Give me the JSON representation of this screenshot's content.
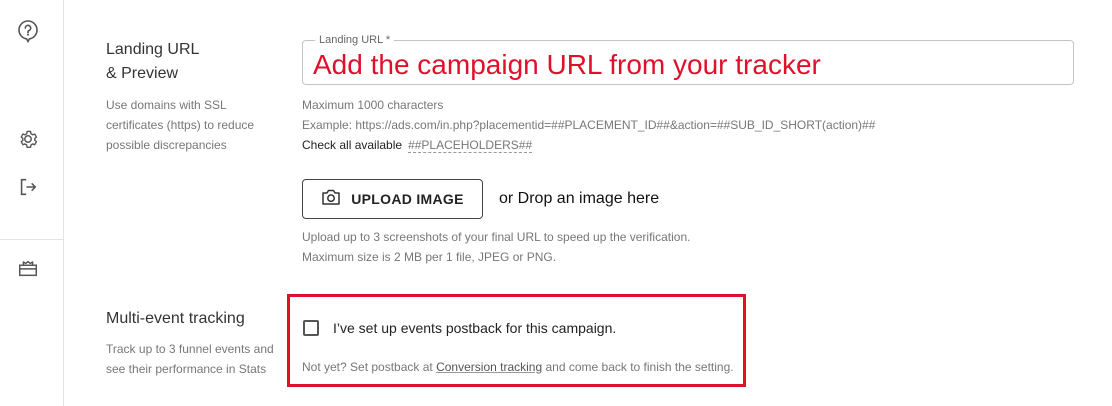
{
  "sidebar": {
    "icons": [
      "help-icon",
      "gear-icon",
      "logout-icon",
      "gift-icon"
    ]
  },
  "landing": {
    "title_line1": "Landing URL",
    "title_line2": "& Preview",
    "desc_line1": "Use domains with SSL",
    "desc_line2": "certificates (https) to reduce",
    "desc_line3": "possible discrepancies",
    "field_label": "Landing URL *",
    "field_annotation": "Add the campaign URL from your tracker",
    "max_chars": "Maximum 1000 characters",
    "example": "Example: https://ads.com/in.php?placementid=##PLACEMENT_ID##&action=##SUB_ID_SHORT(action)##",
    "check_all": "Check all available",
    "placeholders_link": "##PLACEHOLDERS##"
  },
  "upload": {
    "button_label": "UPLOAD IMAGE",
    "drop_text": "or Drop an image here",
    "help_line1": "Upload up to 3 screenshots of your final URL to speed up the verification.",
    "help_line2": "Maximum size is 2 MB per 1 file, JPEG or PNG."
  },
  "multi_event": {
    "title": "Multi-event tracking",
    "desc_line1": "Track up to 3 funnel events and",
    "desc_line2": "see their performance in Stats",
    "checkbox_label": "I’ve set up events postback for this campaign.",
    "checked": false,
    "note_before": "Not yet? Set postback at",
    "note_link": "Conversion tracking",
    "note_after": "and come back to finish the setting."
  },
  "colors": {
    "annotation_red": "#e0102a",
    "border_gray": "#c4c4c4"
  }
}
